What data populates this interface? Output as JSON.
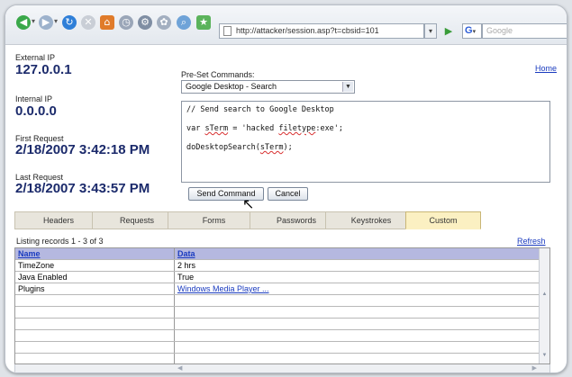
{
  "browser": {
    "url": "http://attacker/session.asp?t=cbsid=101",
    "search_placeholder": "Google"
  },
  "info": {
    "external_ip_label": "External IP",
    "external_ip": "127.0.0.1",
    "internal_ip_label": "Internal IP",
    "internal_ip": "0.0.0.0",
    "first_request_label": "First Request",
    "first_request": "2/18/2007 3:42:18 PM",
    "last_request_label": "Last Request",
    "last_request": "2/18/2007 3:43:57 PM"
  },
  "home_link": "Home",
  "commands": {
    "preset_label": "Pre-Set Commands:",
    "preset_value": "Google Desktop - Search",
    "code": {
      "line1": "// Send search to Google Desktop",
      "line2_prefix": "var ",
      "line2_var": "sTerm",
      "line2_mid": " = 'hacked ",
      "line2_word": "filetype",
      "line2_rest": ":exe';",
      "line3_fn": "doDesktopSearch",
      "line3_open": "(",
      "line3_arg": "sTerm",
      "line3_close": ");"
    },
    "send_button": "Send Command",
    "cancel_button": "Cancel"
  },
  "tabs": [
    "Headers",
    "Requests",
    "Forms",
    "Passwords",
    "Keystrokes",
    "Custom"
  ],
  "active_tab": "Custom",
  "listing": {
    "text": "Listing records 1 - 3 of 3",
    "refresh": "Refresh"
  },
  "table": {
    "columns": [
      "Name",
      "Data"
    ],
    "rows": [
      [
        "TimeZone",
        "2 hrs"
      ],
      [
        "Java Enabled",
        "True"
      ],
      [
        "Plugins",
        "Windows Media Player ..."
      ]
    ]
  },
  "colors": {
    "accent_text": "#1b2a6b",
    "link": "#1a3bbf",
    "active_tab": "#fbf0c2",
    "table_header": "#b5b8e0"
  }
}
